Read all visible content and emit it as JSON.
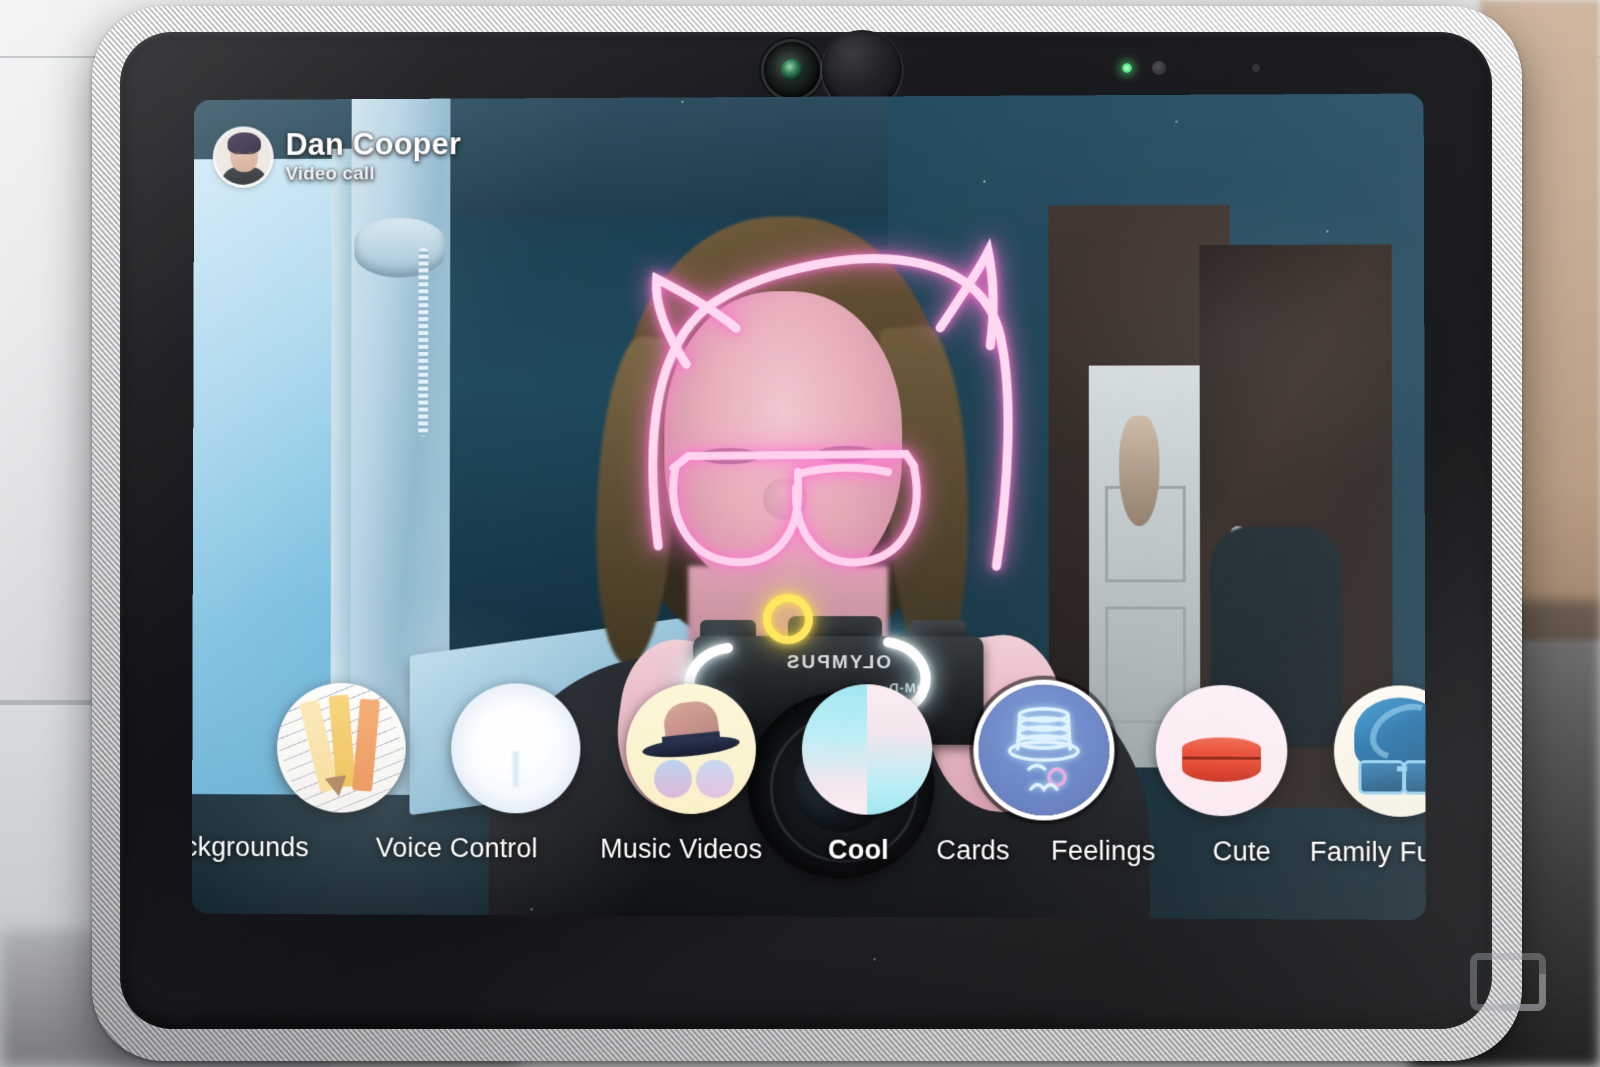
{
  "device": {
    "name": "smart-display",
    "camera": {
      "lens_label": "camera-lens",
      "shutter_label": "privacy-shutter",
      "led_label": "status-led",
      "led_color": "#5ef08a"
    }
  },
  "call": {
    "caller_name": "Dan Cooper",
    "call_type": "Video call",
    "avatar_label": "caller-avatar"
  },
  "subject": {
    "camera_brand": "OLYMPUS",
    "camera_model": "OM-D"
  },
  "ar_filter": {
    "name": "neon-cat-ears",
    "ear_color": "#ffb8e6",
    "glasses_color": "#ffc2ec",
    "monocle_color": "#ffe24a",
    "mustache_color": "#ffffff"
  },
  "carousel": {
    "selected_index": 4,
    "effects": [
      {
        "id": "backgrounds",
        "label": "ckgrounds",
        "icon": "pencils-paper-icon",
        "selected": false
      },
      {
        "id": "voice-control",
        "label": "Voice Control",
        "icon": "voice-glow-icon",
        "selected": false
      },
      {
        "id": "music-videos",
        "label": "Music Videos",
        "icon": "fedora-hat-icon",
        "selected": false
      },
      {
        "id": "cool",
        "label": "Cool",
        "icon": "gradient-split-icon",
        "selected": false
      },
      {
        "id": "cards",
        "label": "Cards",
        "icon": "neon-top-hat-icon",
        "selected": true
      },
      {
        "id": "feelings",
        "label": "Feelings",
        "icon": "red-lips-icon",
        "selected": false
      },
      {
        "id": "cute",
        "label": "Cute",
        "icon": "blue-hair-glasses-icon",
        "selected": false
      },
      {
        "id": "family-fun",
        "label": "Family Fun",
        "icon": "blue-hair-glasses-icon",
        "selected": false
      }
    ]
  },
  "watermark": {
    "label": "publisher-watermark"
  }
}
